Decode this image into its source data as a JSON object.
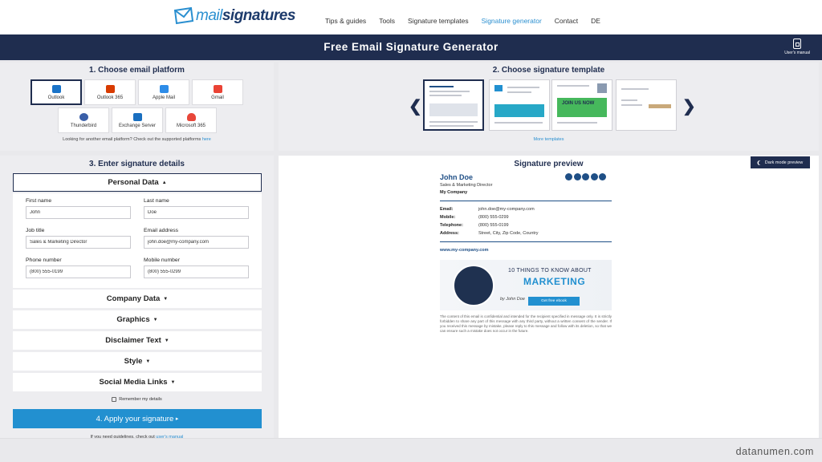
{
  "nav": {
    "logo_prefix": "mail",
    "logo_suffix": "signatures",
    "links": [
      "Tips & guides",
      "Tools",
      "Signature templates",
      "Signature generator",
      "Contact",
      "DE"
    ],
    "active": "Signature generator"
  },
  "header": {
    "title": "Free Email Signature Generator",
    "manual_label": "User's manual"
  },
  "platforms": {
    "title": "1. Choose email platform",
    "items": [
      {
        "label": "Outlook",
        "color": "#1a73c8"
      },
      {
        "label": "Outlook 365",
        "color": "#d83b01"
      },
      {
        "label": "Apple Mail",
        "color": "#2d8ce8"
      },
      {
        "label": "Gmail",
        "color": "#ea4335"
      },
      {
        "label": "Thunderbird",
        "color": "#3a5fa8"
      },
      {
        "label": "Exchange Server",
        "color": "#1a6fc0"
      },
      {
        "label": "Microsoft 365",
        "color": "#e8463a"
      }
    ],
    "selected": "Outlook",
    "note_text": "Looking for another email platform? Check out the supported platforms ",
    "note_link": "here"
  },
  "templates": {
    "title": "2. Choose signature template",
    "more": "More templates",
    "prev_arrow": "❮",
    "next_arrow": "❯",
    "banners": [
      "JOIN US NOW"
    ]
  },
  "details": {
    "title": "3. Enter signature details",
    "sections": [
      {
        "label": "Personal Data",
        "open": true
      },
      {
        "label": "Company Data",
        "open": false
      },
      {
        "label": "Graphics",
        "open": false
      },
      {
        "label": "Disclaimer Text",
        "open": false
      },
      {
        "label": "Style",
        "open": false
      },
      {
        "label": "Social Media Links",
        "open": false
      }
    ],
    "caret_up": "▲",
    "caret_down": "▼",
    "fields": {
      "first_name": {
        "label": "First name",
        "value": "John"
      },
      "last_name": {
        "label": "Last name",
        "value": "Doe"
      },
      "job_title": {
        "label": "Job title",
        "value": "Sales & Marketing Director"
      },
      "email": {
        "label": "Email address",
        "value": "john.doe@my-company.com"
      },
      "phone": {
        "label": "Phone number",
        "value": "(800) 555-0199"
      },
      "mobile": {
        "label": "Mobile number",
        "value": "(800) 555-0299"
      }
    },
    "remember": "Remember my details",
    "apply": "4. Apply your signature",
    "apply_arrow": "▸",
    "guidelines_text": "If you need guidelines, check out ",
    "guidelines_link": "user's manual"
  },
  "preview": {
    "title": "Signature preview",
    "dark_mode": "Dark mode preview",
    "name": "John Doe",
    "role": "Sales & Marketing Director",
    "company": "My Company",
    "contacts": [
      {
        "label": "Email:",
        "value": "john.doe@my-company.com"
      },
      {
        "label": "Mobile:",
        "value": "(800) 555-0299"
      },
      {
        "label": "Telephone:",
        "value": "(800) 555-0199"
      },
      {
        "label": "Address:",
        "value": "Street, City, Zip Code, Country"
      }
    ],
    "website": "www.my-company.com",
    "banner": {
      "line1": "10 THINGS TO KNOW ABOUT",
      "line2": "MARKETING",
      "signature": "by John Doe",
      "cta": "Get free ebook"
    },
    "disclaimer": "The content of this email is confidential and intended for the recipient specified in message only. It is strictly forbidden to share any part of this message with any third party, without a written consent of the sender. If you received this message by mistake, please reply to this message and follow with its deletion, so that we can ensure such a mistake does not occur in the future."
  },
  "footer": {
    "watermark": "datanumen.com"
  },
  "colors": {
    "navy": "#1f2d4f",
    "accent": "#2290d0",
    "name_blue": "#1f4f86"
  }
}
